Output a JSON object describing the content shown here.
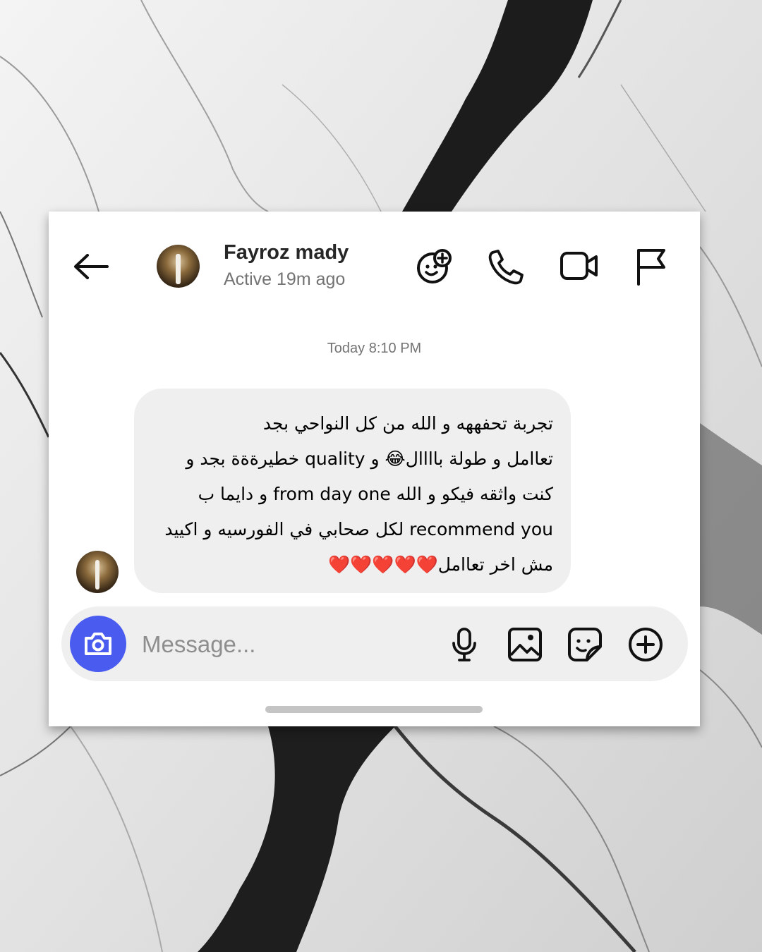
{
  "header": {
    "back_icon": "arrow-left-icon",
    "contact_name": "Fayroz mady",
    "contact_status": "Active 19m ago",
    "actions": [
      {
        "name": "add-emoji-reaction",
        "icon": "emoji-plus-icon"
      },
      {
        "name": "voice-call",
        "icon": "phone-icon"
      },
      {
        "name": "video-call",
        "icon": "video-camera-icon"
      },
      {
        "name": "report",
        "icon": "flag-icon"
      }
    ]
  },
  "conversation": {
    "timestamp": "Today 8:10 PM",
    "message": {
      "lines": [
        "تجربة تحفههه و الله من كل النواحي بجد",
        "تعاامل و طولة باااال😂 و quality خطيرةةة بجد و",
        "كنت واثقه فيكو و الله from day one و دايما ب",
        "recommend you لكل صحابي في الفورسيه و اكييد",
        "مش اخر تعاامل❤️❤️❤️❤️❤️"
      ]
    }
  },
  "composer": {
    "placeholder": "Message...",
    "camera_icon": "camera-icon",
    "icons": [
      "microphone-icon",
      "gallery-icon",
      "sticker-icon",
      "plus-circle-icon"
    ]
  },
  "colors": {
    "camera_button": "#4a5cf0",
    "bubble_bg": "#efefef",
    "secondary_text": "#737373"
  }
}
